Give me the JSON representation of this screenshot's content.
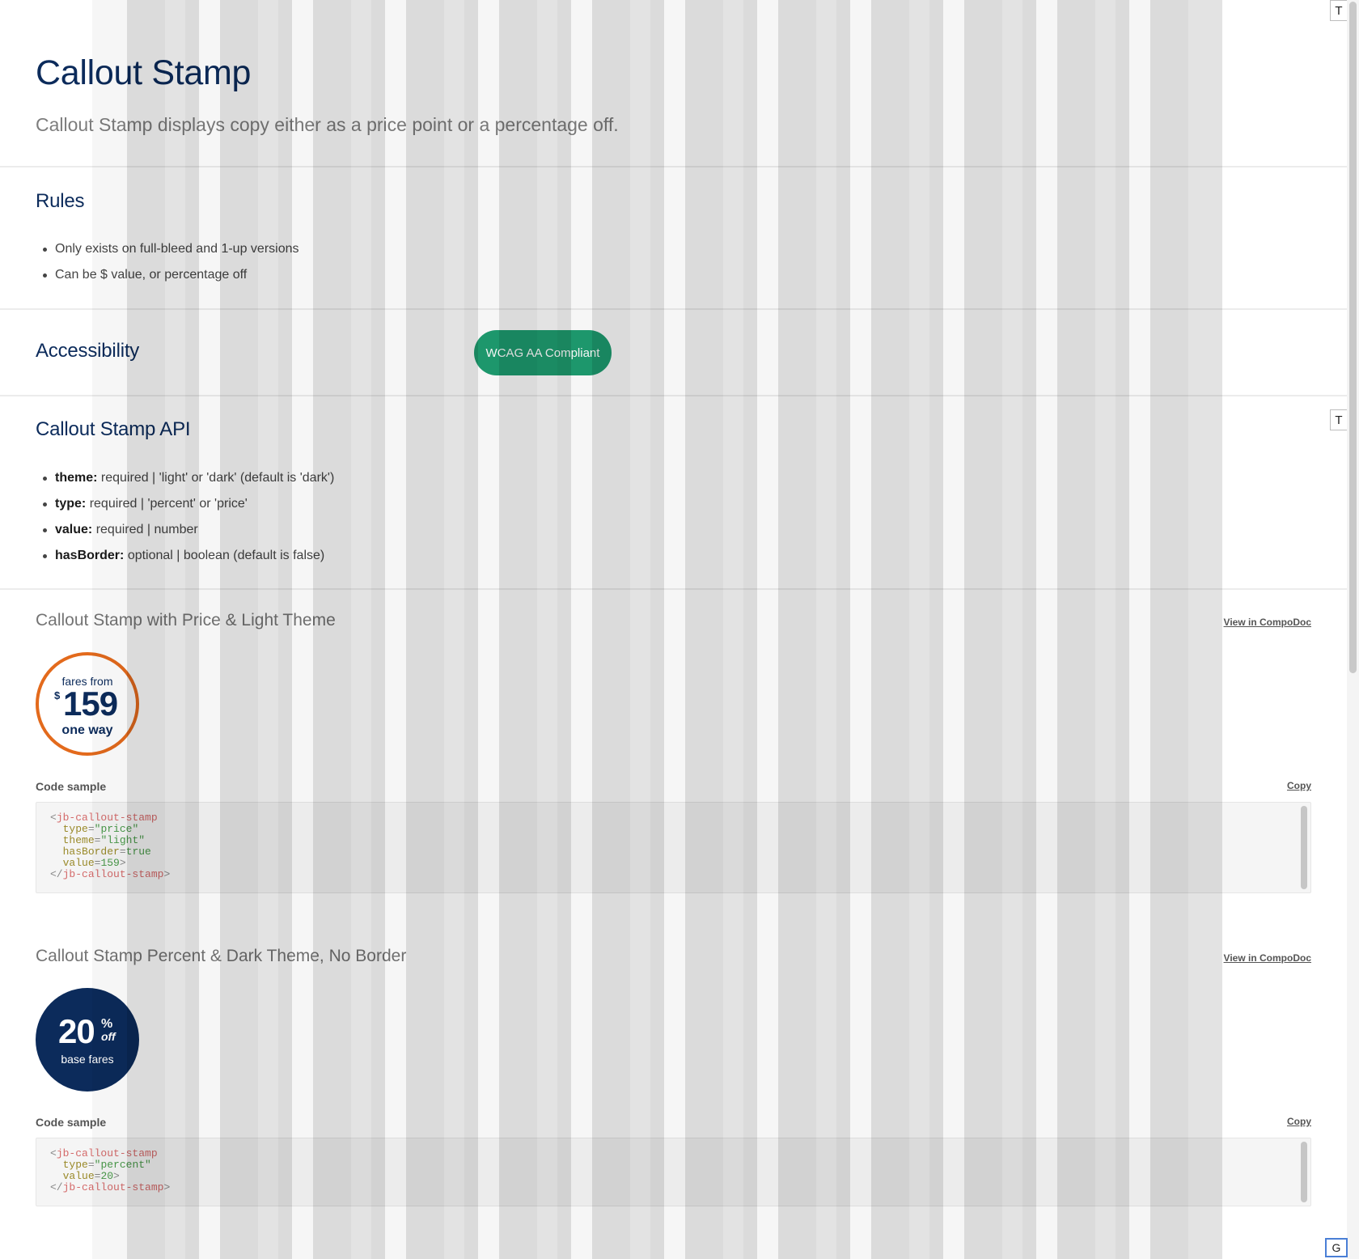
{
  "page": {
    "title": "Callout Stamp",
    "subtitle": "Callout Stamp displays copy either as a price point or a percentage off."
  },
  "rules": {
    "heading": "Rules",
    "items": [
      "Only exists on full-bleed and 1-up versions",
      "Can be $ value, or percentage off"
    ]
  },
  "accessibility": {
    "heading": "Accessibility",
    "badge": "WCAG AA Compliant"
  },
  "api": {
    "heading": "Callout Stamp API",
    "items": [
      {
        "name": "theme:",
        "desc": "required | 'light' or 'dark' (default is 'dark')"
      },
      {
        "name": "type:",
        "desc": "required | 'percent' or 'price'"
      },
      {
        "name": "value:",
        "desc": "required | number"
      },
      {
        "name": "hasBorder:",
        "desc": "optional | boolean (default is false)"
      }
    ]
  },
  "examples": [
    {
      "title": "Callout Stamp with Price & Light Theme",
      "compodoc_label": "View in CompoDoc",
      "stamp": {
        "top_text": "fares from",
        "currency": "$",
        "value": "159",
        "bottom_text": "one way"
      },
      "code_label": "Code sample",
      "copy_label": "Copy",
      "code": {
        "open_tag": "jb-callout-stamp",
        "type_attr": "type",
        "type_val": "\"price\"",
        "theme_attr": "theme",
        "theme_val": "\"light\"",
        "border_attr": "hasBorder",
        "border_val": "true",
        "value_attr": "value",
        "value_val": "159",
        "close_tag": "jb-callout-stamp"
      }
    },
    {
      "title": "Callout Stamp Percent & Dark Theme, No Border",
      "compodoc_label": "View in CompoDoc",
      "stamp": {
        "value": "20",
        "percent": "%",
        "off": "off",
        "bottom_text": "base fares"
      },
      "code_label": "Code sample",
      "copy_label": "Copy",
      "code": {
        "open_tag": "jb-callout-stamp",
        "type_attr": "type",
        "type_val": "\"percent\"",
        "value_attr": "value",
        "value_val": "20",
        "close_tag": "jb-callout-stamp"
      }
    }
  ],
  "side_controls": {
    "top_button": "T",
    "mid_button": "T",
    "bottom_button": "G"
  },
  "colors": {
    "title_navy": "#0c2b5b",
    "badge_green": "#1f9d70",
    "stamp_orange_border": "#e36a1c",
    "stamp_dark_bg": "#0c2b5b"
  }
}
